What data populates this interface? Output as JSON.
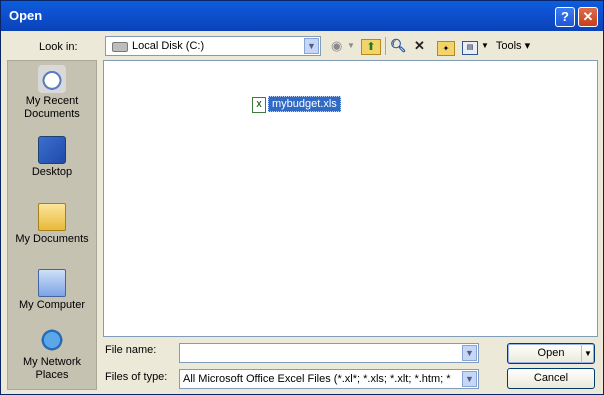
{
  "window": {
    "title": "Open",
    "help_label": "?",
    "close_label": "✕"
  },
  "toolbar": {
    "look_in_label": "Look in:",
    "look_in_value": "Local Disk (C:)",
    "tools_label": "Tools"
  },
  "places": [
    {
      "label": "My Recent Documents",
      "icon": "recent-documents-icon"
    },
    {
      "label": "Desktop",
      "icon": "desktop-icon"
    },
    {
      "label": "My Documents",
      "icon": "my-documents-icon"
    },
    {
      "label": "My Computer",
      "icon": "my-computer-icon"
    },
    {
      "label": "My Network Places",
      "icon": "network-places-icon"
    }
  ],
  "files": [
    {
      "name": "mybudget.xls",
      "type": "excel-file-icon",
      "selected": true
    }
  ],
  "form": {
    "file_name_label": "File name:",
    "file_name_value": "",
    "files_of_type_label": "Files of type:",
    "files_of_type_value": "All Microsoft Office Excel Files (*.xl*; *.xls; *.xlt; *.htm; *"
  },
  "buttons": {
    "open": "Open",
    "cancel": "Cancel"
  },
  "colors": {
    "title_bar": "#0a43b8",
    "selection": "#316ac5",
    "dialog_bg": "#ece9d8"
  }
}
